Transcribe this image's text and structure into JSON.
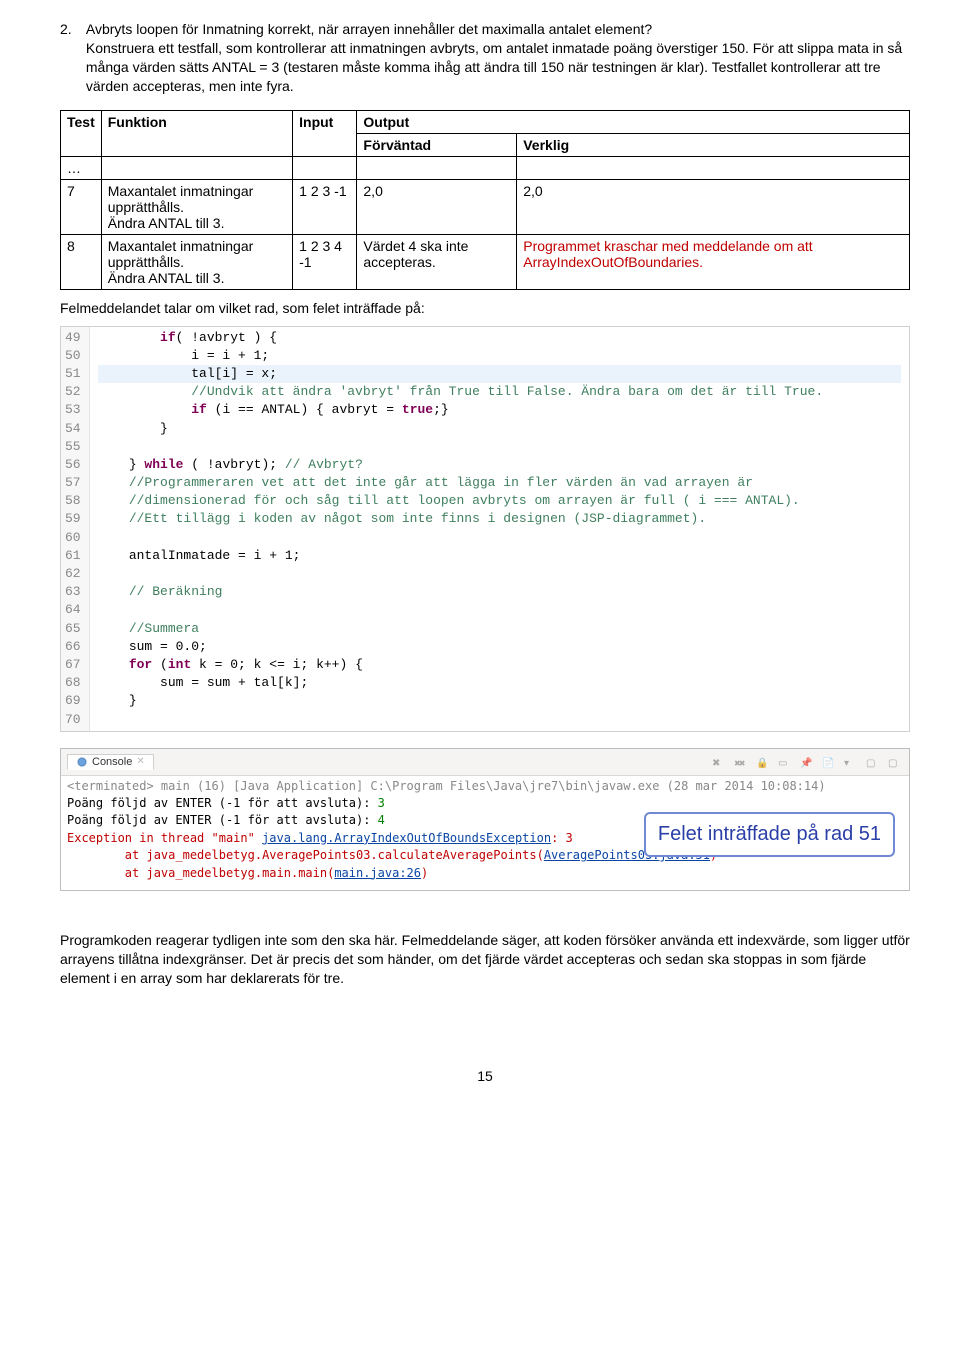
{
  "intro": {
    "num": "2.",
    "q": "Avbryts loopen för Inmatning korrekt, när arrayen innehåller det maximalla antalet element?",
    "p": "Konstruera ett testfall, som kontrollerar att inmatningen avbryts, om antalet inmatade poäng överstiger 150. För att slippa mata in så många värden sätts ANTAL = 3 (testaren måste komma ihåg att ändra till 150 när testningen är klar). Testfallet kontrollerar att tre värden accepteras, men inte fyra."
  },
  "table": {
    "output_label": "Output",
    "headers": {
      "test": "Test",
      "funktion": "Funktion",
      "input": "Input",
      "forvantad": "Förväntad",
      "verklig": "Verklig"
    },
    "ellipsis": "…",
    "rows": [
      {
        "n": "7",
        "funk": "Maxantalet inmatningar upprätthålls.\nÄndra ANTAL till 3.",
        "input": "1 2 3 -1",
        "forv": "2,0",
        "verk": "2,0",
        "verk_red": false
      },
      {
        "n": "8",
        "funk": "Maxantalet inmatningar upprätthålls.\nÄndra ANTAL till 3.",
        "input": "1 2 3 4 -1",
        "forv": "Värdet 4 ska inte accepteras.",
        "verk": "Programmet kraschar med meddelande om att ArrayIndexOutOfBoundaries.",
        "verk_red": true
      }
    ]
  },
  "err_para": "Felmeddelandet talar om vilket rad, som felet inträffade på:",
  "code": {
    "start": 49,
    "lines": [
      {
        "n": 49,
        "html": "        <span class='kw'>if</span>( !avbryt ) {"
      },
      {
        "n": 50,
        "html": "            i = i + 1;"
      },
      {
        "n": 51,
        "html": "            tal[i] = x;",
        "hl": true
      },
      {
        "n": 52,
        "html": "            <span class='cmt'>//Undvik att ändra 'avbryt' från True till False. Ändra bara om det är till True.</span>"
      },
      {
        "n": 53,
        "html": "            <span class='kw'>if</span> (i == ANTAL) { avbryt = <span class='kw'>true</span>;}"
      },
      {
        "n": 54,
        "html": "        }"
      },
      {
        "n": 55,
        "html": ""
      },
      {
        "n": 56,
        "html": "    } <span class='kw'>while</span> ( !avbryt); <span class='cmt'>// Avbryt?</span>"
      },
      {
        "n": 57,
        "html": "    <span class='cmt'>//Programmeraren vet att det inte går att lägga in fler värden än vad arrayen är</span>"
      },
      {
        "n": 58,
        "html": "    <span class='cmt'>//dimensionerad för och såg till att loopen avbryts om arrayen är full ( i === ANTAL).</span>"
      },
      {
        "n": 59,
        "html": "    <span class='cmt'>//Ett tillägg i koden av något som inte finns i designen (JSP-diagrammet).</span>"
      },
      {
        "n": 60,
        "html": ""
      },
      {
        "n": 61,
        "html": "    antalInmatade = i + 1;"
      },
      {
        "n": 62,
        "html": ""
      },
      {
        "n": 63,
        "html": "    <span class='cmt'>// Beräkning</span>"
      },
      {
        "n": 64,
        "html": ""
      },
      {
        "n": 65,
        "html": "    <span class='cmt'>//Summera</span>"
      },
      {
        "n": 66,
        "html": "    sum = 0.0;"
      },
      {
        "n": 67,
        "html": "    <span class='kw'>for</span> (<span class='kw'>int</span> k = 0; k &lt;= i; k++) {"
      },
      {
        "n": 68,
        "html": "        sum = sum + tal[k];"
      },
      {
        "n": 69,
        "html": "    }"
      },
      {
        "n": 70,
        "html": ""
      }
    ]
  },
  "console": {
    "tab": "Console",
    "header": "<terminated> main (16) [Java Application] C:\\Program Files\\Java\\jre7\\bin\\javaw.exe (28 mar 2014 10:08:14)",
    "l1_label": "Poäng följd av ENTER (-1 för att avsluta): ",
    "l1_in": "3",
    "l2_label": "Poäng följd av ENTER (-1 för att avsluta): ",
    "l2_in": "4",
    "exc_pre": "Exception in thread \"main\" ",
    "exc_link": "java.lang.ArrayIndexOutOfBoundsException",
    "exc_post": ": 3",
    "at1_pre": "        at java_medelbetyg.AveragePoints03.calculateAveragePoints(",
    "at1_link": "AveragePoints03.java:51",
    "at1_post": ")",
    "at2_pre": "        at java_medelbetyg.main.main(",
    "at2_link": "main.java:26",
    "at2_post": ")",
    "annot": "Felet inträffade på rad 51"
  },
  "bottom": "Programkoden reagerar tydligen inte som den ska här. Felmeddelande säger, att koden försöker använda ett indexvärde, som ligger utför arrayens tillåtna indexgränser. Det är precis det som händer, om det fjärde värdet accepteras och sedan ska stoppas in som fjärde element i en array som har deklarerats för tre.",
  "page_num": "15"
}
